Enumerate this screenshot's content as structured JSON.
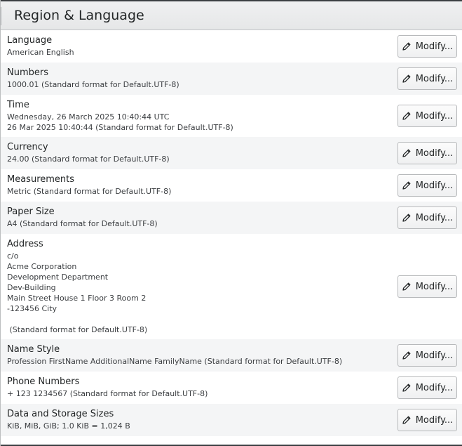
{
  "header": {
    "title": "Region & Language"
  },
  "button_label": "Modify...",
  "rows": [
    {
      "label": "Language",
      "lines": [
        "American English"
      ]
    },
    {
      "label": "Numbers",
      "lines": [
        "1000.01 (Standard format for Default.UTF-8)"
      ]
    },
    {
      "label": "Time",
      "lines": [
        "Wednesday, 26 March 2025 10:40:44 UTC",
        "26 Mar 2025 10:40:44 (Standard format for Default.UTF-8)"
      ]
    },
    {
      "label": "Currency",
      "lines": [
        "24.00 (Standard format for Default.UTF-8)"
      ]
    },
    {
      "label": "Measurements",
      "lines": [
        "Metric (Standard format for Default.UTF-8)"
      ]
    },
    {
      "label": "Paper Size",
      "lines": [
        "A4 (Standard format for Default.UTF-8)"
      ]
    },
    {
      "label": "Address",
      "lines": [
        "c/o",
        "Acme Corporation",
        "Development Department",
        "Dev-Building",
        "Main Street House 1 Floor 3 Room 2",
        "-123456 City",
        "",
        " (Standard format for Default.UTF-8)"
      ]
    },
    {
      "label": "Name Style",
      "lines": [
        "Profession FirstName AdditionalName FamilyName (Standard format for Default.UTF-8)"
      ]
    },
    {
      "label": "Phone Numbers",
      "lines": [
        "+ 123 1234567 (Standard format for Default.UTF-8)"
      ]
    },
    {
      "label": "Data and Storage Sizes",
      "lines": [
        "KiB, MiB, GiB; 1.0 KiB = 1,024 B"
      ]
    }
  ]
}
